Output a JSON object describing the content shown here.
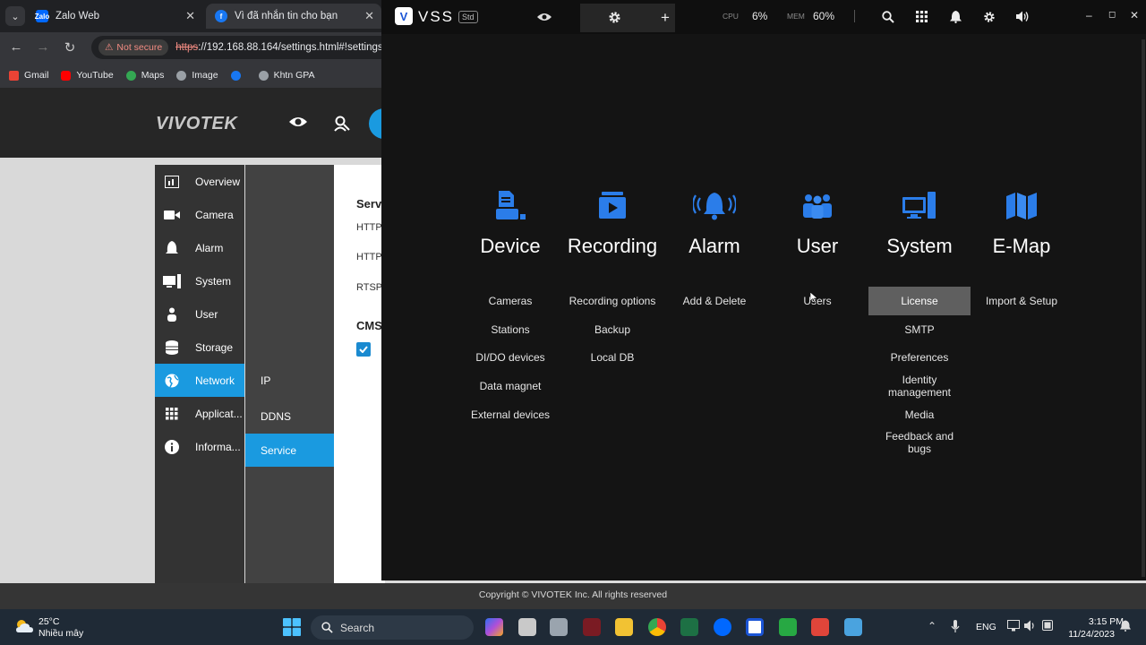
{
  "browser": {
    "tabs": [
      {
        "title": "Zalo Web",
        "favicon": "Zalo"
      },
      {
        "title": "Vì đã nhắn tin cho bạn",
        "favicon": "f"
      }
    ],
    "not_secure": "Not secure",
    "url_scheme": "https",
    "url_rest": "://192.168.88.164/settings.html#!settings",
    "bookmarks": [
      "Gmail",
      "YouTube",
      "Maps",
      "Image",
      "",
      "Khtn GPA"
    ]
  },
  "vivotek": {
    "logo": "VIVOTEK",
    "nav": [
      "Overview",
      "Camera",
      "Alarm",
      "System",
      "User",
      "Storage",
      "Network",
      "Applicat...",
      "Informa..."
    ],
    "active_nav": "Network",
    "subnav": [
      "IP",
      "DDNS",
      "Service"
    ],
    "active_sub": "Service",
    "content": {
      "title": "Servi",
      "rows": [
        "HTTP",
        "HTTP",
        "RTSP"
      ],
      "cms_title": "CMS"
    },
    "copyright": "Copyright © VIVOTEK Inc. All rights reserved"
  },
  "vss": {
    "name": "VSS",
    "edition": "Std",
    "cpu_label": "CPU",
    "cpu_value": "6%",
    "mem_label": "MEM",
    "mem_value": "60%",
    "categories": [
      {
        "label": "Device",
        "icon": "device-icon",
        "options": [
          "Cameras",
          "Stations",
          "DI/DO devices",
          "Data magnet",
          "External devices"
        ]
      },
      {
        "label": "Recording",
        "icon": "recording-icon",
        "options": [
          "Recording options",
          "Backup",
          "Local DB"
        ]
      },
      {
        "label": "Alarm",
        "icon": "alarm-bell-icon",
        "options": [
          "Add & Delete"
        ]
      },
      {
        "label": "User",
        "icon": "users-icon",
        "options": [
          "Users"
        ]
      },
      {
        "label": "System",
        "icon": "monitor-icon",
        "options": [
          "License",
          "SMTP",
          "Preferences",
          "Identity management",
          "Media",
          "Feedback and bugs"
        ]
      },
      {
        "label": "E-Map",
        "icon": "map-icon",
        "options": [
          "Import & Setup"
        ]
      }
    ],
    "highlighted_option": "License",
    "accent": "#2b7de9"
  },
  "taskbar": {
    "temperature": "25°C",
    "weather": "Nhiều mây",
    "search": "Search",
    "language": "ENG",
    "time": "3:15 PM",
    "date": "11/24/2023"
  }
}
